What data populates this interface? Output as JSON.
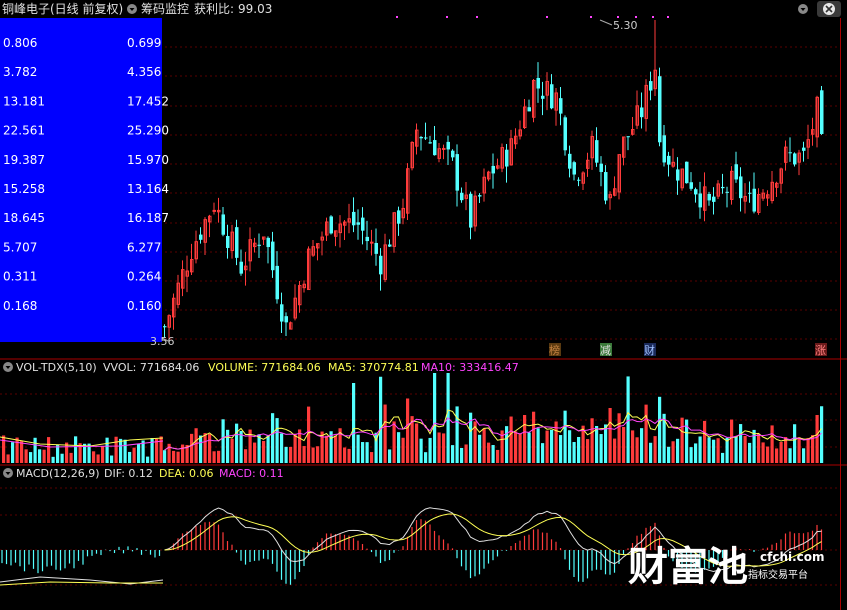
{
  "header": {
    "stock_title": "铜峰电子(日线 前复权)",
    "indicator_name": "筹码监控",
    "profit_label": "获利比:",
    "profit_value": "99.03"
  },
  "chip_table": {
    "rows": [
      [
        "0.806",
        "0.699"
      ],
      [
        "3.782",
        "4.356"
      ],
      [
        "13.181",
        "17.452"
      ],
      [
        "22.561",
        "25.290"
      ],
      [
        "19.387",
        "15.970"
      ],
      [
        "15.258",
        "13.164"
      ],
      [
        "18.645",
        "16.187"
      ],
      [
        "5.707",
        "6.277"
      ],
      [
        "0.311",
        "0.264"
      ],
      [
        "0.168",
        "0.160"
      ]
    ]
  },
  "price_panel": {
    "high_label": "5.30",
    "low_label": "3.56",
    "markers": [
      {
        "text": "榜",
        "color": "#c08040",
        "bg": "#5a3a10"
      },
      {
        "text": "减",
        "color": "#e0e0e0",
        "bg": "#3a7a3a"
      },
      {
        "text": "财",
        "color": "#a0c0ff",
        "bg": "#1a2a5a"
      },
      {
        "text": "涨",
        "color": "#ff8080",
        "bg": "#6a1a1a"
      }
    ]
  },
  "vol_panel": {
    "name": "VOL-TDX(5,10)",
    "vvol": "VVOL: 771684.06",
    "volume": "VOLUME: 771684.06",
    "ma5": "MA5: 370774.81",
    "ma10": "MA10: 333416.47",
    "colors": {
      "vvol": "#e0e0e0",
      "volume": "#ffff55",
      "ma5": "#ffff55",
      "ma10": "#ff44ff"
    }
  },
  "macd_panel": {
    "name": "MACD(12,26,9)",
    "dif": "DIF: 0.12",
    "dea": "DEA: 0.06",
    "macd": "MACD: 0.11",
    "colors": {
      "dif": "#e0e0e0",
      "dea": "#ffff55",
      "macd": "#ff44ff"
    }
  },
  "watermark": {
    "brand": "财富池",
    "domain": "cfchi.com",
    "slogan": "指标交易平台"
  },
  "chart_data": {
    "type": "candlestick",
    "up_color": "#ff3b3b",
    "down_color": "#54ffff",
    "price_high": 5.3,
    "price_low": 3.56,
    "anchors": [
      [
        0,
        3.62
      ],
      [
        6,
        4.05
      ],
      [
        11,
        4.3
      ],
      [
        17,
        3.95
      ],
      [
        22,
        4.15
      ],
      [
        27,
        3.62
      ],
      [
        32,
        4.0
      ],
      [
        37,
        4.2
      ],
      [
        43,
        4.18
      ],
      [
        48,
        3.98
      ],
      [
        53,
        4.3
      ],
      [
        56,
        4.7
      ],
      [
        60,
        4.62
      ],
      [
        64,
        4.5
      ],
      [
        68,
        4.2
      ],
      [
        72,
        4.45
      ],
      [
        77,
        4.6
      ],
      [
        82,
        4.95
      ],
      [
        87,
        4.88
      ],
      [
        91,
        4.45
      ],
      [
        95,
        4.6
      ],
      [
        99,
        4.3
      ],
      [
        101,
        4.58
      ],
      [
        106,
        4.8
      ],
      [
        109,
        5.05
      ],
      [
        110,
        4.65
      ],
      [
        113,
        4.5
      ],
      [
        117,
        4.42
      ],
      [
        121,
        4.28
      ],
      [
        126,
        4.4
      ],
      [
        130,
        4.3
      ],
      [
        134,
        4.4
      ],
      [
        138,
        4.55
      ],
      [
        142,
        4.55
      ],
      [
        145,
        4.8
      ],
      [
        146,
        4.6
      ]
    ]
  }
}
